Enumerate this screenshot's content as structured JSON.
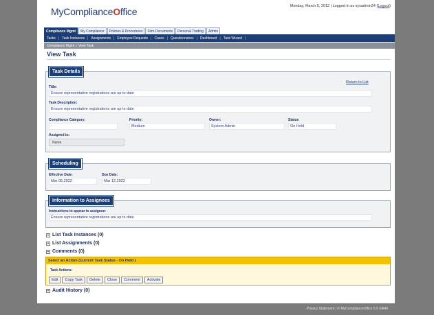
{
  "brand": {
    "logo_pre": "MyCompliance",
    "logo_check": "O",
    "logo_post": "ffice"
  },
  "topright": {
    "text": "Monday, March 5, 2012 | Logged in as sysadmin24 (",
    "logout": "Logout",
    "close": ")"
  },
  "main_tabs": [
    "Compliance Mgmt",
    "My Compliance",
    "Policies & Procedures",
    "Firm Documents",
    "Personal Trading",
    "Admin"
  ],
  "sub_nav": [
    "Tasks",
    "Task Instances",
    "Assignments",
    "Employee Requests",
    "Cases",
    "Questionnaires",
    "Dashboard",
    "Task Wizard"
  ],
  "breadcrumb": "Compliance Mgmt »  View Task",
  "page_title": "View Task",
  "task_details": {
    "header": "Task Details",
    "return_link": "Return to List",
    "title_label": "Title:",
    "title_value": "Ensure representative registrations are up to date",
    "desc_label": "Task Description:",
    "desc_value": "Ensure representative registrations are up to date",
    "category_label": "Compliance Category:",
    "category_value": "-",
    "priority_label": "Priority:",
    "priority_value": "Medium",
    "owner_label": "Owner:",
    "owner_value": "System Admin",
    "status_label": "Status",
    "status_value": "On Hold",
    "assigned_label": "Assigned to:",
    "assigned_name": "Name"
  },
  "scheduling": {
    "header": "Scheduling",
    "effective_label": "Effective Date:",
    "effective_value": "Mar 05,2022",
    "due_label": "Due Date:",
    "due_value": "Mar 12,2022"
  },
  "info": {
    "header": "Information to Assignees",
    "instr_label": "Instructions to appear to assignee:",
    "instr_value": "Ensure representative registrations are up to date"
  },
  "lists": {
    "instances": "List Task Instances (0)",
    "assignments": "List Assignments (0)",
    "comments": "Comments (0)",
    "audit": "Audit History (0)"
  },
  "actions": {
    "header": "Select an Action (Current Task Status - On Hold )",
    "label": "Task Actions:",
    "buttons": [
      "Edit",
      "Copy Task",
      "Delete",
      "Close",
      "Comment",
      "Activate"
    ]
  },
  "footer": "Privacy Statement   |   © MyComplianceOffice 6.9 r0640"
}
